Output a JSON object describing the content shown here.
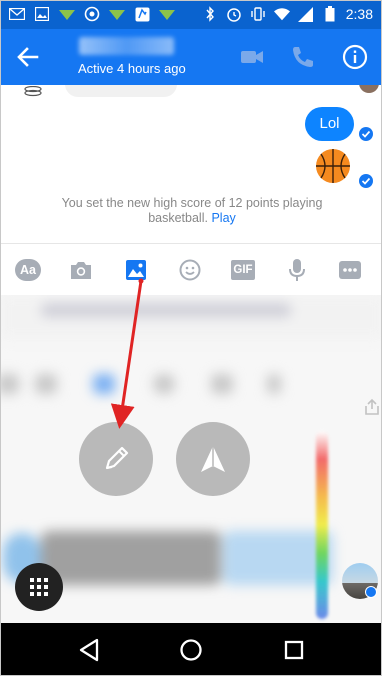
{
  "status_bar": {
    "time": "2:38",
    "notification_icons": [
      "gmail-icon",
      "image-icon",
      "app-icon",
      "sync-icon",
      "app-icon",
      "reddit-icon",
      "app-icon"
    ],
    "system_icons": [
      "bluetooth-icon",
      "alarm-icon",
      "vibrate-icon",
      "wifi-icon",
      "signal-icon",
      "battery-icon"
    ]
  },
  "app_bar": {
    "contact_name": "",
    "active_status": "Active 4 hours ago",
    "accent_color": "#1577f2"
  },
  "chat": {
    "messages": [
      {
        "type": "text",
        "text": "Lol",
        "sent": true
      },
      {
        "type": "emoji",
        "icon": "basketball-icon",
        "sent": true
      }
    ],
    "game_note": "You set the new high score of 12 points playing basketball.",
    "game_action": "Play"
  },
  "toolbar": {
    "items": [
      "text-style-button",
      "camera-button",
      "gallery-button",
      "emoji-button",
      "gif-button",
      "microphone-button",
      "more-button"
    ],
    "text_style_label": "Aa",
    "gif_label": "GIF",
    "active_item": "gallery-button"
  },
  "editor": {
    "buttons": [
      "pencil-button",
      "send-button"
    ],
    "annotation_color": "#e02424"
  }
}
